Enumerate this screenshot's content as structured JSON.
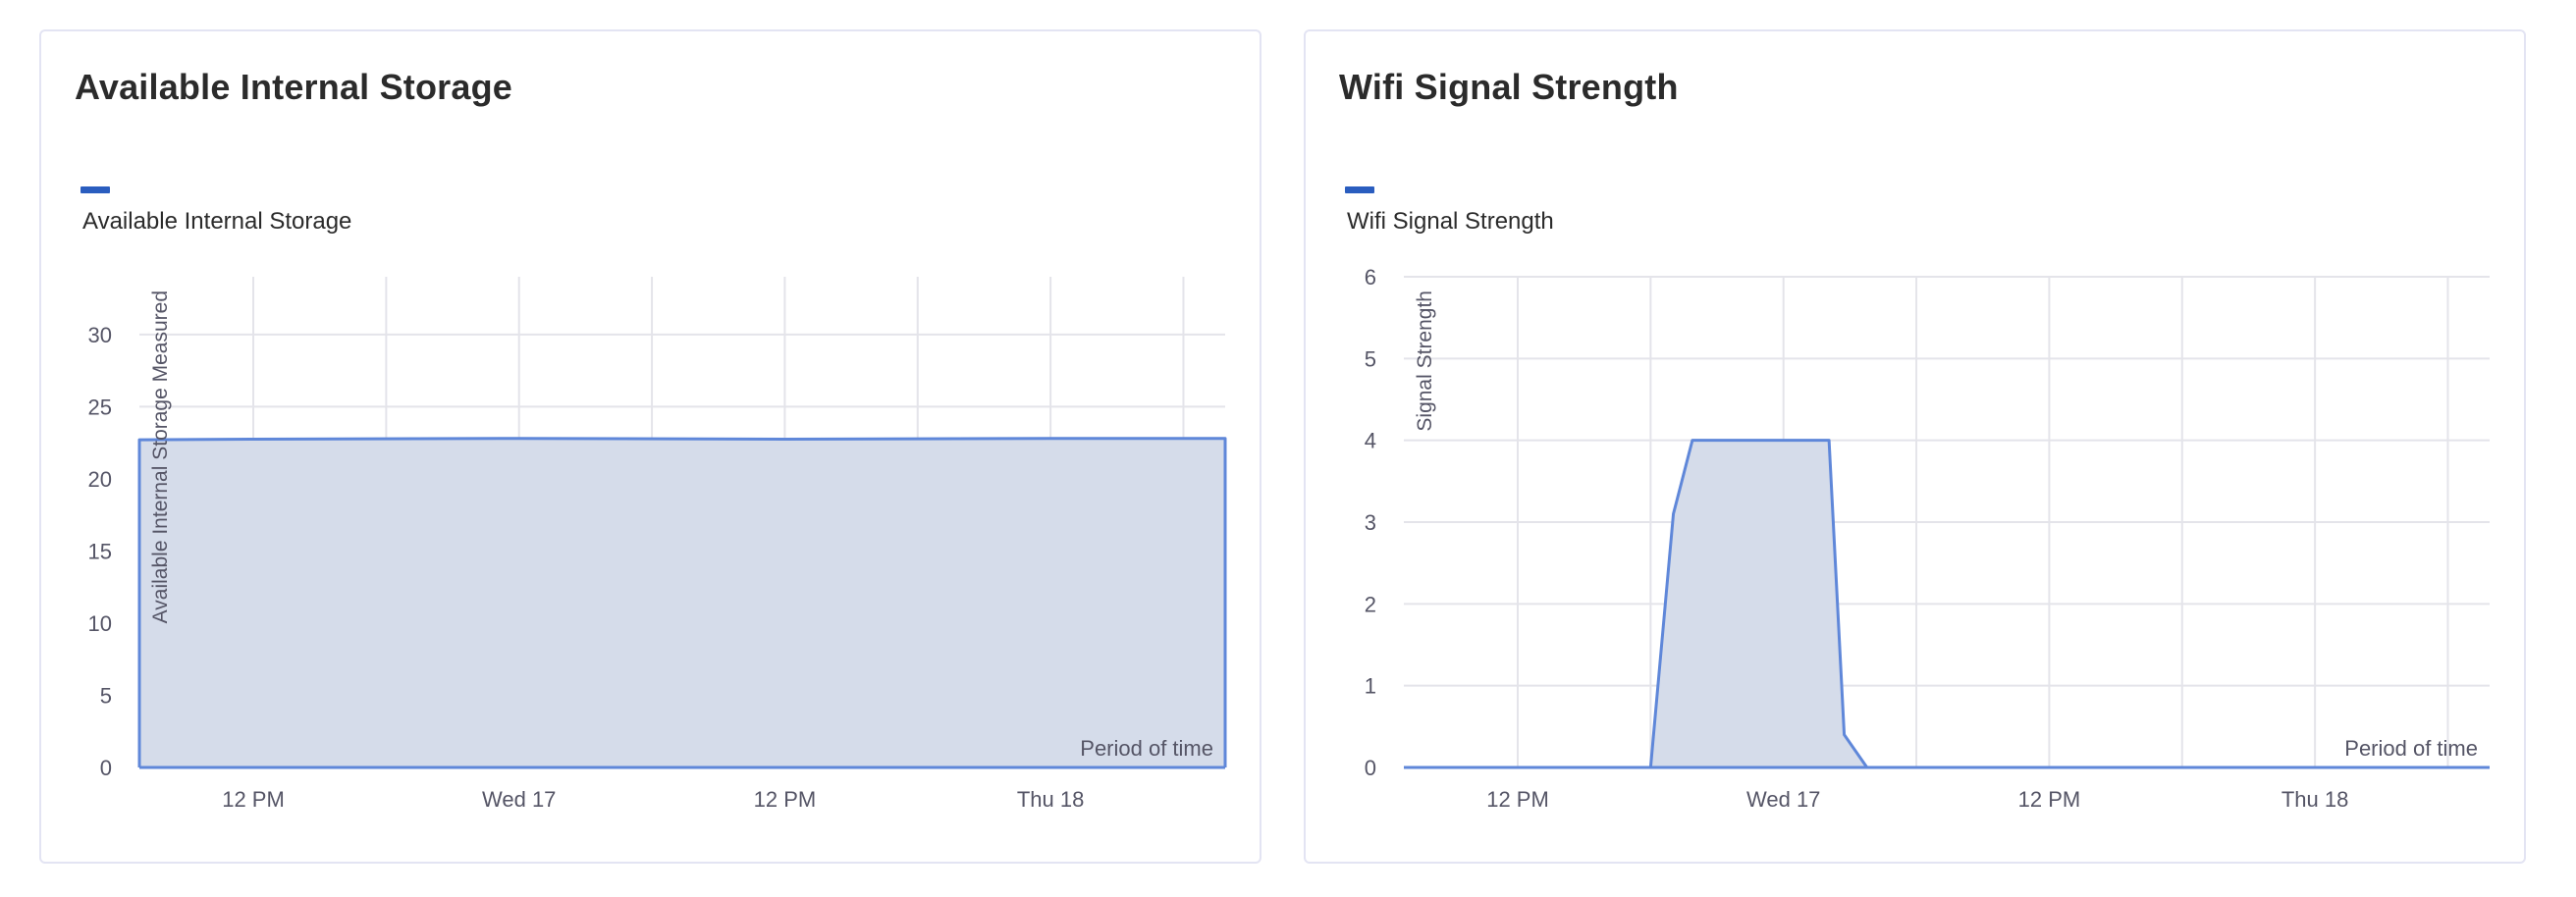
{
  "colors": {
    "series": "#5f87d9",
    "fill": "#d5dcea",
    "legend": "#2a5dbf",
    "grid": "#e4e4ea",
    "text": "#555566"
  },
  "charts": [
    {
      "title": "Available Internal Storage",
      "legend": "Available Internal Storage"
    },
    {
      "title": "Wifi Signal Strength",
      "legend": "Wifi Signal Strength"
    }
  ],
  "chart_data": [
    {
      "type": "area",
      "title": "Available Internal Storage",
      "legend": [
        "Available Internal Storage"
      ],
      "ylabel": "Available Internal Storage Measured",
      "xlabel": "Period of time",
      "x_ticks": [
        "12 PM",
        "Wed 17",
        "12 PM",
        "Thu 18"
      ],
      "x_tick_pos": [
        3.0,
        10.0,
        17.0,
        24.0
      ],
      "xlim": [
        0,
        28.6
      ],
      "ylim": [
        0,
        34
      ],
      "y_ticks": [
        0,
        5,
        10,
        15,
        20,
        25,
        30
      ],
      "vgrid_pos": [
        3.0,
        6.5,
        10.0,
        13.5,
        17.0,
        20.5,
        24.0,
        27.5
      ],
      "series": [
        {
          "name": "Available Internal Storage",
          "points": [
            [
              0,
              0
            ],
            [
              0,
              22.7
            ],
            [
              3.0,
              22.75
            ],
            [
              10.0,
              22.8
            ],
            [
              17.0,
              22.75
            ],
            [
              24.0,
              22.8
            ],
            [
              28.6,
              22.8
            ],
            [
              28.6,
              0
            ]
          ]
        }
      ]
    },
    {
      "type": "area",
      "title": "Wifi Signal Strength",
      "legend": [
        "Wifi Signal Strength"
      ],
      "ylabel": "Signal Strength",
      "xlabel": "Period of time",
      "x_ticks": [
        "12 PM",
        "Wed 17",
        "12 PM",
        "Thu 18"
      ],
      "x_tick_pos": [
        3.0,
        10.0,
        17.0,
        24.0
      ],
      "xlim": [
        0,
        28.6
      ],
      "ylim": [
        0,
        6
      ],
      "y_ticks": [
        0,
        1,
        2,
        3,
        4,
        5,
        6
      ],
      "vgrid_pos": [
        3.0,
        6.5,
        10.0,
        13.5,
        17.0,
        20.5,
        24.0,
        27.5
      ],
      "series": [
        {
          "name": "Wifi Signal Strength",
          "points": [
            [
              0,
              0
            ],
            [
              6.5,
              0
            ],
            [
              7.1,
              3.1
            ],
            [
              7.6,
              4.0
            ],
            [
              11.2,
              4.0
            ],
            [
              11.6,
              0.4
            ],
            [
              12.2,
              0
            ],
            [
              28.6,
              0
            ]
          ]
        }
      ]
    }
  ]
}
